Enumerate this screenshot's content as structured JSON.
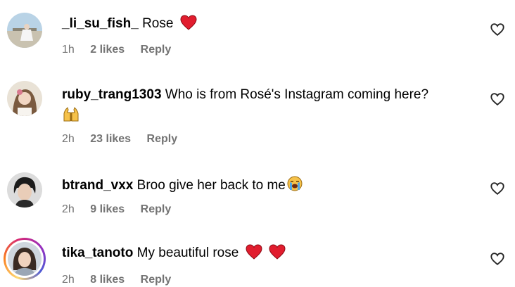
{
  "comments": [
    {
      "username": "_li_su_fish_",
      "text": "Rose",
      "emoji": "red-heart",
      "time": "1h",
      "likes": "2 likes",
      "reply": "Reply"
    },
    {
      "username": "ruby_trang1303",
      "text": "Who is from Rosé's Instagram coming here?",
      "emoji": "raising-hands",
      "time": "2h",
      "likes": "23 likes",
      "reply": "Reply"
    },
    {
      "username": "btrand_vxx",
      "text": "Broo give her back to me",
      "emoji": "loudly-crying-face",
      "time": "2h",
      "likes": "9 likes",
      "reply": "Reply"
    },
    {
      "username": "tika_tanoto",
      "text": "My beautiful rose",
      "emoji": "two-red-hearts",
      "time": "2h",
      "likes": "8 likes",
      "reply": "Reply"
    }
  ],
  "colors": {
    "meta_text": "#737373",
    "heart": "#e11d2e"
  }
}
